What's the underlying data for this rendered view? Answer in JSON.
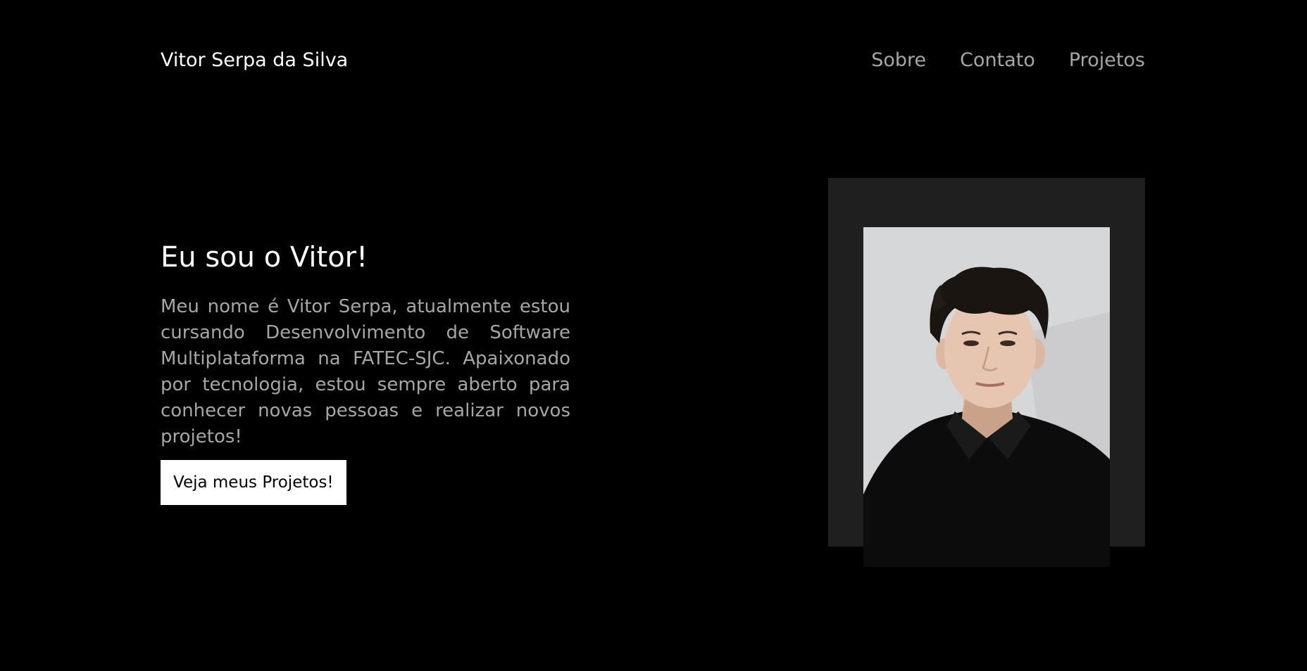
{
  "header": {
    "brand": "Vitor Serpa da Silva",
    "nav": [
      {
        "label": "Sobre"
      },
      {
        "label": "Contato"
      },
      {
        "label": "Projetos"
      }
    ]
  },
  "hero": {
    "title": "Eu sou o Vitor!",
    "description": "Meu nome é Vitor Serpa, atualmente estou cursando Desenvolvimento de Software Multiplataforma na FATEC-SJC. Apaixonado por tecnologia, estou sempre aberto para conhecer novas pessoas e realizar novos projetos!",
    "cta_label": "Veja meus Projetos!"
  },
  "photo": {
    "icon": "portrait-photo"
  },
  "colors": {
    "background": "#000000",
    "text_primary": "#ffffff",
    "text_muted": "#a6a6a6",
    "frame": "#1f1f1f",
    "button_bg": "#ffffff"
  }
}
